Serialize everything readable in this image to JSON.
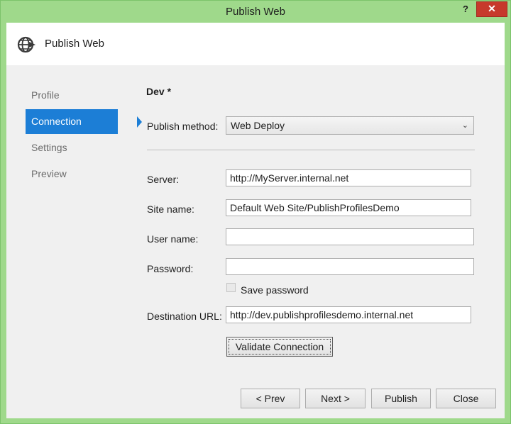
{
  "window": {
    "title": "Publish Web",
    "help_label": "?",
    "close_label": "✕"
  },
  "header": {
    "icon": "globe-publish-icon",
    "title": "Publish Web"
  },
  "nav": {
    "items": [
      {
        "label": "Profile",
        "active": false
      },
      {
        "label": "Connection",
        "active": true
      },
      {
        "label": "Settings",
        "active": false
      },
      {
        "label": "Preview",
        "active": false
      }
    ]
  },
  "form": {
    "profile_name": "Dev *",
    "publish_method_label": "Publish method:",
    "publish_method_value": "Web Deploy",
    "server_label": "Server:",
    "server_value": "http://MyServer.internal.net",
    "site_name_label": "Site name:",
    "site_name_value": "Default Web Site/PublishProfilesDemo",
    "user_name_label": "User name:",
    "user_name_value": "",
    "password_label": "Password:",
    "password_value": "",
    "save_password_label": "Save password",
    "save_password_checked": false,
    "destination_url_label": "Destination URL:",
    "destination_url_value": "http://dev.publishprofilesdemo.internal.net",
    "validate_label": "Validate Connection"
  },
  "footer": {
    "prev_label": "< Prev",
    "next_label": "Next >",
    "publish_label": "Publish",
    "close_label": "Close"
  },
  "colors": {
    "titlebar": "#9fd98b",
    "accent": "#1c7ed6",
    "close_button": "#c7392c"
  }
}
